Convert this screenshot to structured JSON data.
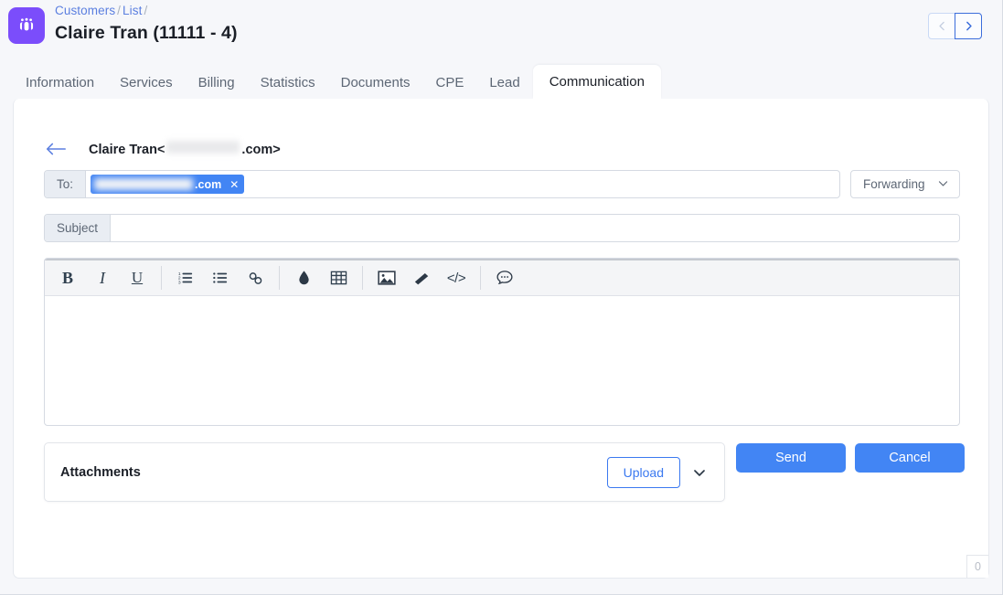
{
  "header": {
    "brand_icon": "people-group-icon",
    "breadcrumb": [
      {
        "label": "Customers",
        "link": true
      },
      {
        "label": "List",
        "link": true
      }
    ],
    "breadcrumb_separator": "/",
    "title": "Claire Tran (11111 - 4)",
    "nav": {
      "prev_icon": "chevron-left-icon",
      "next_icon": "chevron-right-icon"
    },
    "accent_color": "#7b4dfb",
    "link_color": "#5b7fe0"
  },
  "tabs": [
    {
      "label": "Information",
      "active": false
    },
    {
      "label": "Services",
      "active": false
    },
    {
      "label": "Billing",
      "active": false
    },
    {
      "label": "Statistics",
      "active": false
    },
    {
      "label": "Documents",
      "active": false
    },
    {
      "label": "CPE",
      "active": false
    },
    {
      "label": "Lead",
      "active": false
    },
    {
      "label": "Communication",
      "active": true
    }
  ],
  "mail": {
    "back_icon": "arrow-left-icon",
    "from_name": "Claire Tran",
    "from_open_bracket": "<",
    "from_domain_suffix": ".com>",
    "to": {
      "label": "To:",
      "chip_text": ".com",
      "chip_remove_icon": "close-icon"
    },
    "forwarding": {
      "value": "Forwarding",
      "caret_icon": "chevron-down-icon"
    },
    "subject": {
      "label": "Subject",
      "value": "",
      "placeholder": ""
    },
    "toolbar": [
      {
        "name": "bold-icon",
        "glyph": "B"
      },
      {
        "name": "italic-icon",
        "glyph": "I"
      },
      {
        "name": "underline-icon",
        "glyph": "U"
      },
      {
        "name": "ordered-list-icon",
        "glyph": ""
      },
      {
        "name": "unordered-list-icon",
        "glyph": ""
      },
      {
        "name": "link-icon",
        "glyph": ""
      },
      {
        "name": "color-droplet-icon",
        "glyph": ""
      },
      {
        "name": "table-icon",
        "glyph": ""
      },
      {
        "name": "image-icon",
        "glyph": ""
      },
      {
        "name": "eraser-icon",
        "glyph": ""
      },
      {
        "name": "code-icon",
        "glyph": "</>"
      },
      {
        "name": "comment-icon",
        "glyph": ""
      }
    ],
    "body": {
      "value": "",
      "char_count": "0"
    }
  },
  "attachments": {
    "title": "Attachments",
    "upload_label": "Upload",
    "caret_icon": "chevron-down-icon"
  },
  "actions": {
    "send_label": "Send",
    "cancel_label": "Cancel",
    "primary_color": "#4285f4"
  }
}
